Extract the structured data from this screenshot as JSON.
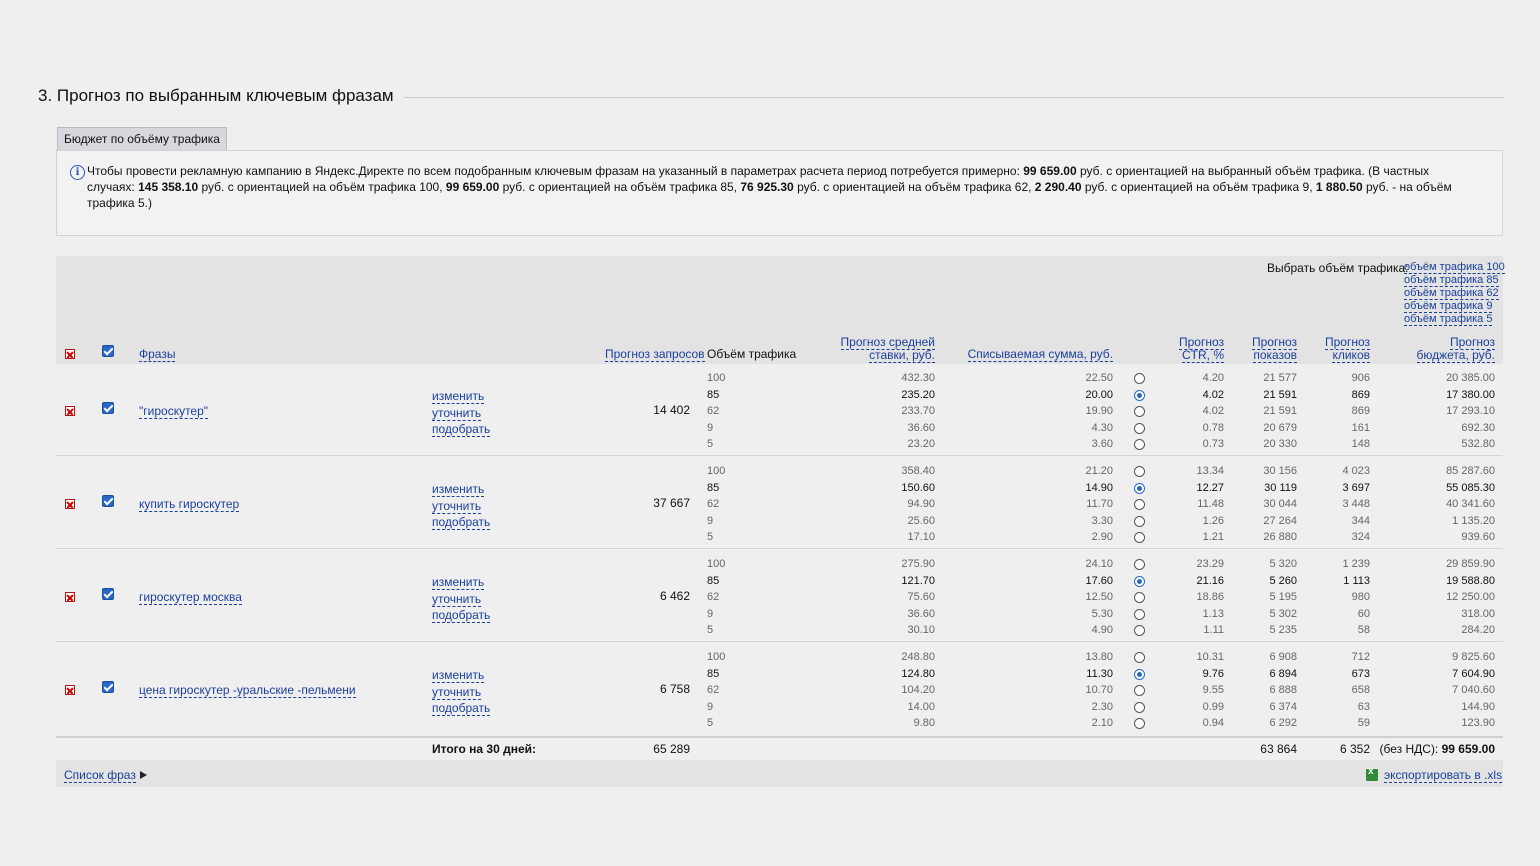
{
  "section_title": "3. Прогноз по выбранным ключевым фразам",
  "tab_label": "Бюджет по объёму трафика",
  "info": {
    "t1": "Чтобы провести рекламную кампанию в Яндекс.Директе по всем подобранным ключевым фразам на указанный в параметрах расчета период потребуется примерно: ",
    "b1": "99 659.00",
    "t2": " руб. с ориентацией на выбранный объём трафика. (В частных случаях: ",
    "b2": "145 358.10",
    "t3": " руб. с ориентацией на объём трафика 100, ",
    "b3": "99 659.00",
    "t4": " руб. с ориентацией на объём трафика 85, ",
    "b4": "76 925.30",
    "t5": " руб. с ориентацией на объём трафика 62, ",
    "b5": "2 290.40",
    "t6": " руб. с ориентацией на объём трафика 9, ",
    "b6": "1 880.50",
    "t7": " руб. - на объём трафика 5.)"
  },
  "select_volume": {
    "label": "Выбрать объём трафика:",
    "links": [
      "объём трафика 100",
      "объём трафика 85",
      "объём трафика 62",
      "объём трафика 9",
      "объём трафика 5"
    ]
  },
  "headers": {
    "phrases": "Фразы",
    "requests": "Прогноз запросов",
    "volume": "Объём трафика",
    "bid_l1": "Прогноз средней",
    "bid_l2": "ставки, руб.",
    "charge": "Списываемая сумма, руб.",
    "ctr_l1": "Прогноз",
    "ctr_l2": "CTR, %",
    "shows_l1": "Прогноз",
    "shows_l2": "показов",
    "clicks_l1": "Прогноз",
    "clicks_l2": "кликов",
    "budget_l1": "Прогноз",
    "budget_l2": "бюджета, руб."
  },
  "actions": [
    "изменить",
    "уточнить",
    "подобрать"
  ],
  "rows": [
    {
      "phrase": "\"гироскутер\"",
      "requests": "14 402",
      "levels": [
        {
          "vol": "100",
          "bid": "432.30",
          "charge": "22.50",
          "ctr": "4.20",
          "shows": "21 577",
          "clicks": "906",
          "budget": "20 385.00",
          "selected": false
        },
        {
          "vol": "85",
          "bid": "235.20",
          "charge": "20.00",
          "ctr": "4.02",
          "shows": "21 591",
          "clicks": "869",
          "budget": "17 380.00",
          "selected": true
        },
        {
          "vol": "62",
          "bid": "233.70",
          "charge": "19.90",
          "ctr": "4.02",
          "shows": "21 591",
          "clicks": "869",
          "budget": "17 293.10",
          "selected": false
        },
        {
          "vol": "9",
          "bid": "36.60",
          "charge": "4.30",
          "ctr": "0.78",
          "shows": "20 679",
          "clicks": "161",
          "budget": "692.30",
          "selected": false
        },
        {
          "vol": "5",
          "bid": "23.20",
          "charge": "3.60",
          "ctr": "0.73",
          "shows": "20 330",
          "clicks": "148",
          "budget": "532.80",
          "selected": false
        }
      ]
    },
    {
      "phrase": "купить гироскутер",
      "requests": "37 667",
      "levels": [
        {
          "vol": "100",
          "bid": "358.40",
          "charge": "21.20",
          "ctr": "13.34",
          "shows": "30 156",
          "clicks": "4 023",
          "budget": "85 287.60",
          "selected": false
        },
        {
          "vol": "85",
          "bid": "150.60",
          "charge": "14.90",
          "ctr": "12.27",
          "shows": "30 119",
          "clicks": "3 697",
          "budget": "55 085.30",
          "selected": true
        },
        {
          "vol": "62",
          "bid": "94.90",
          "charge": "11.70",
          "ctr": "11.48",
          "shows": "30 044",
          "clicks": "3 448",
          "budget": "40 341.60",
          "selected": false
        },
        {
          "vol": "9",
          "bid": "25.60",
          "charge": "3.30",
          "ctr": "1.26",
          "shows": "27 264",
          "clicks": "344",
          "budget": "1 135.20",
          "selected": false
        },
        {
          "vol": "5",
          "bid": "17.10",
          "charge": "2.90",
          "ctr": "1.21",
          "shows": "26 880",
          "clicks": "324",
          "budget": "939.60",
          "selected": false
        }
      ]
    },
    {
      "phrase": "гироскутер москва",
      "requests": "6 462",
      "levels": [
        {
          "vol": "100",
          "bid": "275.90",
          "charge": "24.10",
          "ctr": "23.29",
          "shows": "5 320",
          "clicks": "1 239",
          "budget": "29 859.90",
          "selected": false
        },
        {
          "vol": "85",
          "bid": "121.70",
          "charge": "17.60",
          "ctr": "21.16",
          "shows": "5 260",
          "clicks": "1 113",
          "budget": "19 588.80",
          "selected": true
        },
        {
          "vol": "62",
          "bid": "75.60",
          "charge": "12.50",
          "ctr": "18.86",
          "shows": "5 195",
          "clicks": "980",
          "budget": "12 250.00",
          "selected": false
        },
        {
          "vol": "9",
          "bid": "36.60",
          "charge": "5.30",
          "ctr": "1.13",
          "shows": "5 302",
          "clicks": "60",
          "budget": "318.00",
          "selected": false
        },
        {
          "vol": "5",
          "bid": "30.10",
          "charge": "4.90",
          "ctr": "1.11",
          "shows": "5 235",
          "clicks": "58",
          "budget": "284.20",
          "selected": false
        }
      ]
    },
    {
      "phrase": "цена гироскутер -уральские -пельмени",
      "requests": "6 758",
      "levels": [
        {
          "vol": "100",
          "bid": "248.80",
          "charge": "13.80",
          "ctr": "10.31",
          "shows": "6 908",
          "clicks": "712",
          "budget": "9 825.60",
          "selected": false
        },
        {
          "vol": "85",
          "bid": "124.80",
          "charge": "11.30",
          "ctr": "9.76",
          "shows": "6 894",
          "clicks": "673",
          "budget": "7 604.90",
          "selected": true
        },
        {
          "vol": "62",
          "bid": "104.20",
          "charge": "10.70",
          "ctr": "9.55",
          "shows": "6 888",
          "clicks": "658",
          "budget": "7 040.60",
          "selected": false
        },
        {
          "vol": "9",
          "bid": "14.00",
          "charge": "2.30",
          "ctr": "0.99",
          "shows": "6 374",
          "clicks": "63",
          "budget": "144.90",
          "selected": false
        },
        {
          "vol": "5",
          "bid": "9.80",
          "charge": "2.10",
          "ctr": "0.94",
          "shows": "6 292",
          "clicks": "59",
          "budget": "123.90",
          "selected": false
        }
      ]
    }
  ],
  "totals": {
    "label": "Итого на 30 дней:",
    "requests": "65 289",
    "shows": "63 864",
    "clicks": "6 352",
    "budget_prefix": "(без НДС): ",
    "budget": "99 659.00"
  },
  "footer": {
    "phrase_list": "Список фраз",
    "export": "экспортировать в .xls"
  }
}
